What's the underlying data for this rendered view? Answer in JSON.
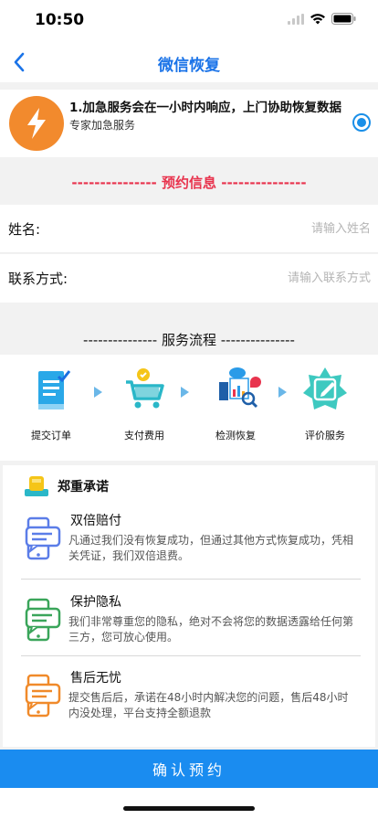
{
  "status_bar": {
    "time": "10:50"
  },
  "navbar": {
    "title": "微信恢复"
  },
  "service_option": {
    "headline": "1.加急服务会在一小时内响应，上门协助恢复数据",
    "subtitle": "专家加急服务",
    "selected": true,
    "accent_color": "#f28a2d"
  },
  "booking": {
    "title": "--------------- 预约信息 ---------------",
    "name_label": "姓名:",
    "name_placeholder": "请输入姓名",
    "name_value": "",
    "contact_label": "联系方式:",
    "contact_placeholder": "请输入联系方式",
    "contact_value": ""
  },
  "flow": {
    "title": "--------------- 服务流程 ---------------",
    "steps": [
      {
        "label": "提交订单",
        "icon": "document-check-icon"
      },
      {
        "label": "支付费用",
        "icon": "shopping-cart-icon"
      },
      {
        "label": "检测恢复",
        "icon": "data-analysis-icon"
      },
      {
        "label": "评价服务",
        "icon": "edit-star-icon"
      }
    ]
  },
  "promise": {
    "title": "郑重承诺",
    "items": [
      {
        "title": "双倍赔付",
        "desc": "凡通过我们没有恢复成功，但通过其他方式恢复成功，凭相关凭证，我们双倍退费。",
        "color": "#5b7de8"
      },
      {
        "title": "保护隐私",
        "desc": "我们非常尊重您的隐私，绝对不会将您的数据透露给任何第三方，您可放心使用。",
        "color": "#3aa55a"
      },
      {
        "title": "售后无忧",
        "desc": "提交售后后，承诺在48小时内解决您的问题，售后48小时内没处理，平台支持全额退款",
        "color": "#f08a2a"
      }
    ]
  },
  "confirm_button": {
    "label": "确认预约"
  },
  "colors": {
    "primary": "#1a8cf0",
    "accent_red": "#e8344e"
  }
}
